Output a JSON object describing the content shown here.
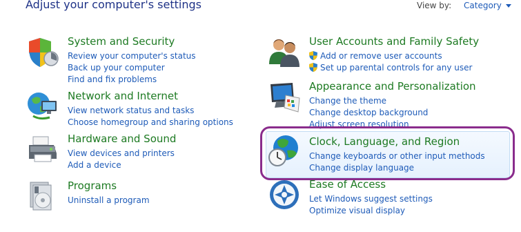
{
  "header": {
    "title": "Adjust your computer's settings",
    "view_by_label": "View by:",
    "view_by_value": "Category"
  },
  "categories": {
    "system": {
      "title": "System and Security",
      "links": [
        "Review your computer's status",
        "Back up your computer",
        "Find and fix problems"
      ]
    },
    "network": {
      "title": "Network and Internet",
      "links": [
        "View network status and tasks",
        "Choose homegroup and sharing options"
      ]
    },
    "hardware": {
      "title": "Hardware and Sound",
      "links": [
        "View devices and printers",
        "Add a device"
      ]
    },
    "programs": {
      "title": "Programs",
      "links": [
        "Uninstall a program"
      ]
    },
    "users": {
      "title": "User Accounts and Family Safety",
      "links": [
        "Add or remove user accounts",
        "Set up parental controls for any user"
      ]
    },
    "appearance": {
      "title": "Appearance and Personalization",
      "links": [
        "Change the theme",
        "Change desktop background",
        "Adjust screen resolution"
      ]
    },
    "clock": {
      "title": "Clock, Language, and Region",
      "links": [
        "Change keyboards or other input methods",
        "Change display language"
      ]
    },
    "ease": {
      "title": "Ease of Access",
      "links": [
        "Let Windows suggest settings",
        "Optimize visual display"
      ]
    }
  },
  "icons": {
    "system": "shield-icon",
    "network": "globe-network-icon",
    "hardware": "printer-icon",
    "programs": "programs-icon",
    "users": "users-icon",
    "appearance": "monitor-palette-icon",
    "clock": "globe-clock-icon",
    "ease": "ease-of-access-icon",
    "uac": "uac-shield-icon"
  },
  "colors": {
    "category_title": "#1d7a22",
    "link": "#1e5bb8",
    "header": "#1e3287",
    "highlight_border": "#8a2c8c"
  }
}
